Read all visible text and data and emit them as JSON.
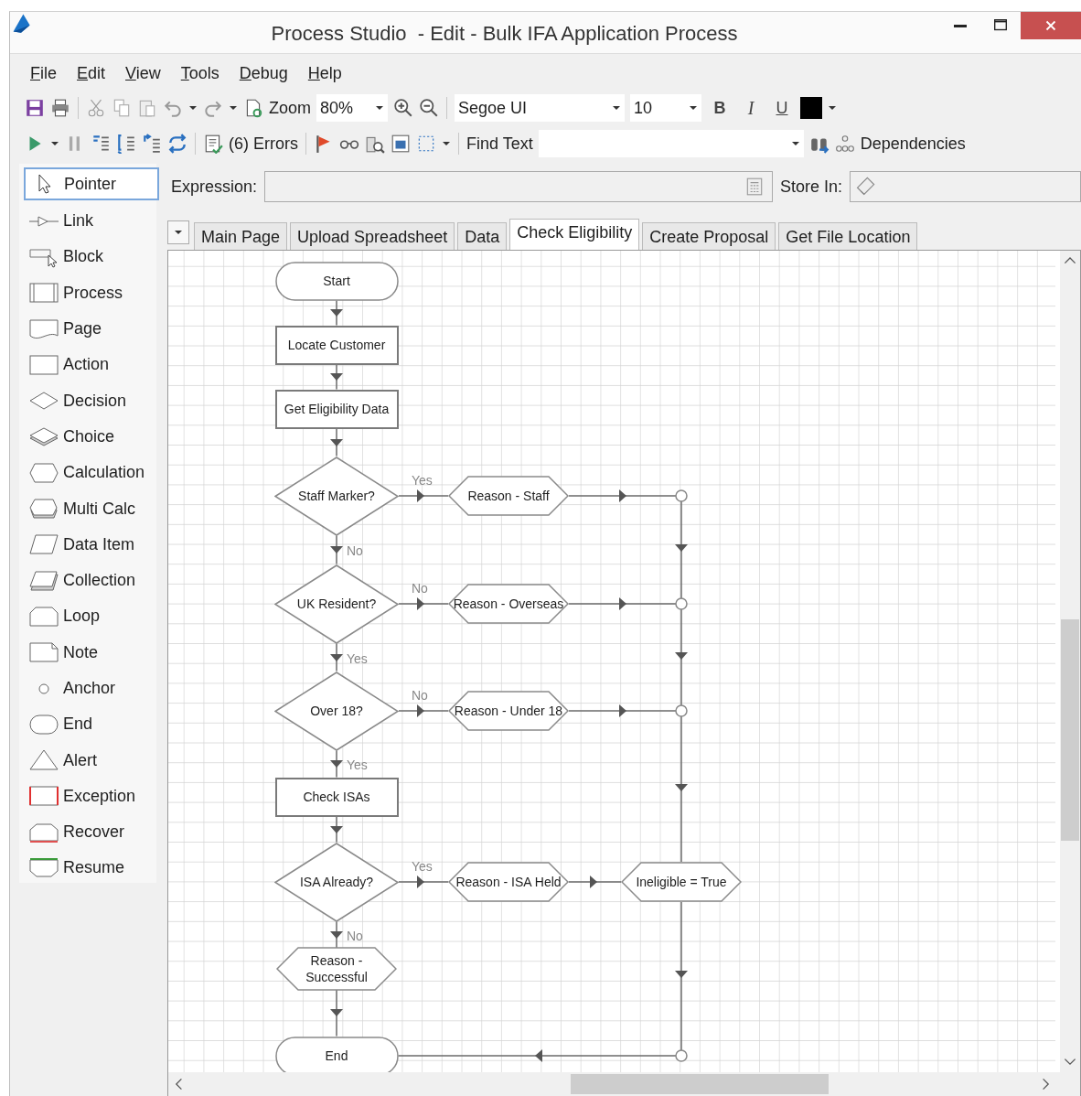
{
  "window": {
    "title": "Process Studio  - Edit - Bulk IFA Application Process"
  },
  "menu": [
    "File",
    "Edit",
    "View",
    "Tools",
    "Debug",
    "Help"
  ],
  "toolbar": {
    "zoom_label": "Zoom",
    "zoom": "80%",
    "font": "Segoe UI",
    "font_size": "10",
    "bold": "B",
    "italic": "I",
    "underline": "U",
    "errors": "(6) Errors",
    "find_label": "Find Text",
    "dependencies": "Dependencies"
  },
  "palette": [
    {
      "label": "Pointer",
      "kind": "pointer",
      "selected": true
    },
    {
      "label": "Link",
      "kind": "link",
      "selected": false
    },
    {
      "label": "Block",
      "kind": "block",
      "selected": false
    },
    {
      "label": "Process",
      "kind": "process",
      "selected": false
    },
    {
      "label": "Page",
      "kind": "page",
      "selected": false
    },
    {
      "label": "Action",
      "kind": "action",
      "selected": false
    },
    {
      "label": "Decision",
      "kind": "decision",
      "selected": false
    },
    {
      "label": "Choice",
      "kind": "choice",
      "selected": false
    },
    {
      "label": "Calculation",
      "kind": "calculation",
      "selected": false
    },
    {
      "label": "Multi Calc",
      "kind": "multicalc",
      "selected": false
    },
    {
      "label": "Data Item",
      "kind": "dataitem",
      "selected": false
    },
    {
      "label": "Collection",
      "kind": "collection",
      "selected": false
    },
    {
      "label": "Loop",
      "kind": "loop",
      "selected": false
    },
    {
      "label": "Note",
      "kind": "note",
      "selected": false
    },
    {
      "label": "Anchor",
      "kind": "anchor",
      "selected": false
    },
    {
      "label": "End",
      "kind": "end",
      "selected": false
    },
    {
      "label": "Alert",
      "kind": "alert",
      "selected": false
    },
    {
      "label": "Exception",
      "kind": "exception",
      "selected": false
    },
    {
      "label": "Recover",
      "kind": "recover",
      "selected": false
    },
    {
      "label": "Resume",
      "kind": "resume",
      "selected": false
    }
  ],
  "expression": {
    "label": "Expression:",
    "store_label": "Store In:"
  },
  "tabs": [
    {
      "label": "Main Page",
      "selected": false
    },
    {
      "label": "Upload Spreadsheet",
      "selected": false
    },
    {
      "label": "Data",
      "selected": false
    },
    {
      "label": "Check Eligibility",
      "selected": true
    },
    {
      "label": "Create Proposal",
      "selected": false
    },
    {
      "label": "Get File Location",
      "selected": false
    }
  ],
  "diagram": {
    "nodes": [
      {
        "kind": "terminator",
        "label": "Start"
      },
      {
        "kind": "action",
        "label": "Locate Customer"
      },
      {
        "kind": "action",
        "label": "Get Eligibility Data"
      },
      {
        "kind": "decision",
        "label": "Staff Marker?",
        "right_label": "Yes",
        "down_label": "No"
      },
      {
        "kind": "calculation",
        "label": "Reason - Staff"
      },
      {
        "kind": "decision",
        "label": "UK Resident?",
        "right_label": "No",
        "down_label": "Yes"
      },
      {
        "kind": "calculation",
        "label": "Reason - Overseas"
      },
      {
        "kind": "decision",
        "label": "Over 18?",
        "right_label": "No",
        "down_label": "Yes"
      },
      {
        "kind": "calculation",
        "label": "Reason - Under 18"
      },
      {
        "kind": "action",
        "label": "Check ISAs"
      },
      {
        "kind": "decision",
        "label": "ISA Already?",
        "right_label": "Yes",
        "down_label": "No"
      },
      {
        "kind": "calculation",
        "label": "Reason - ISA Held"
      },
      {
        "kind": "calculation",
        "label": "Ineligible = True"
      },
      {
        "kind": "calculation",
        "label": "Reason - Successful"
      },
      {
        "kind": "terminator",
        "label": "End"
      }
    ]
  }
}
